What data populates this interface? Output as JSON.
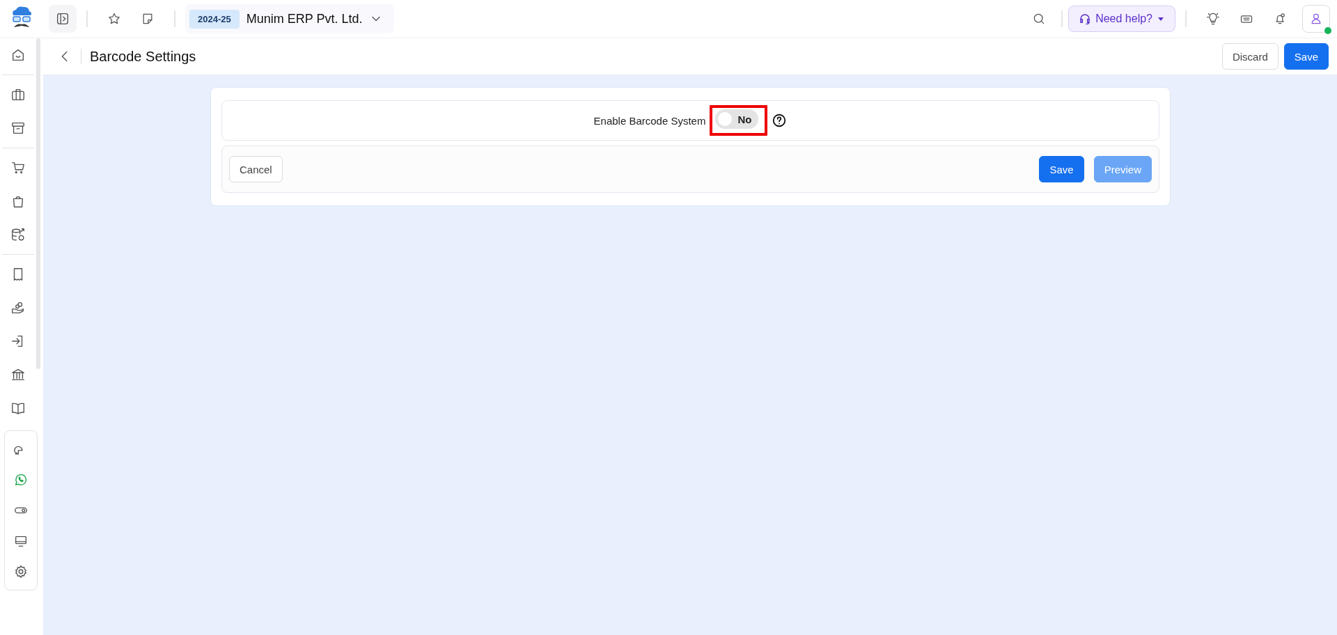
{
  "topbar": {
    "financial_year": "2024-25",
    "company": "Munim ERP Pvt. Ltd.",
    "help_button": "Need help?",
    "user_online": true
  },
  "page_header": {
    "title": "Barcode Settings",
    "buttons": [
      {
        "label": "Discard",
        "kind": "secondary"
      },
      {
        "label": "Save",
        "kind": "primary"
      }
    ]
  },
  "settings": {
    "label": "Enable Barcode System",
    "toggle": {
      "on": false,
      "text": "No",
      "highlighted": true
    }
  },
  "actions": [
    {
      "label": "Cancel",
      "kind": "secondary",
      "disabled": false
    },
    {
      "label": "Save",
      "kind": "primary",
      "disabled": false
    },
    {
      "label": "Preview",
      "kind": "primary",
      "disabled": true
    }
  ]
}
